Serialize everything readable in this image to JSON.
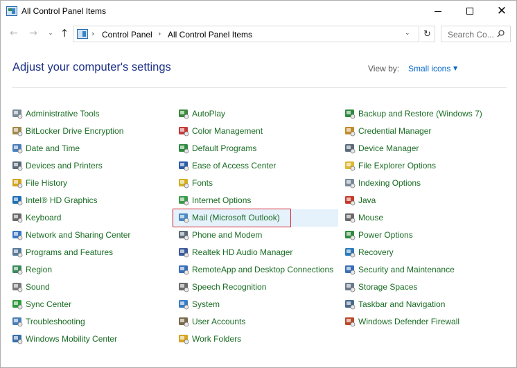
{
  "window": {
    "title": "All Control Panel Items",
    "controls": {
      "minimize": "minimize",
      "maximize": "maximize",
      "close": "✕"
    }
  },
  "address": {
    "crumbs": [
      "Control Panel",
      "All Control Panel Items"
    ],
    "search_placeholder": "Search Co..."
  },
  "content": {
    "heading": "Adjust your computer's settings",
    "view_by_label": "View by:",
    "view_by_value": "Small icons"
  },
  "columns": [
    [
      {
        "label": "Administrative Tools",
        "icon": "gear-tools-icon",
        "color": "#7a8a99"
      },
      {
        "label": "BitLocker Drive Encryption",
        "icon": "drive-key-icon",
        "color": "#a08a4a"
      },
      {
        "label": "Date and Time",
        "icon": "clock-icon",
        "color": "#4a7fb8"
      },
      {
        "label": "Devices and Printers",
        "icon": "printer-icon",
        "color": "#5a6a7a"
      },
      {
        "label": "File History",
        "icon": "file-history-icon",
        "color": "#d4a520"
      },
      {
        "label": "Intel® HD Graphics",
        "icon": "intel-icon",
        "color": "#1f6fb5"
      },
      {
        "label": "Keyboard",
        "icon": "keyboard-icon",
        "color": "#6a6a6a"
      },
      {
        "label": "Network and Sharing Center",
        "icon": "network-icon",
        "color": "#3a78c4"
      },
      {
        "label": "Programs and Features",
        "icon": "programs-icon",
        "color": "#5a7a9a"
      },
      {
        "label": "Region",
        "icon": "globe-clock-icon",
        "color": "#3a8a5a"
      },
      {
        "label": "Sound",
        "icon": "speaker-icon",
        "color": "#7a7a7a"
      },
      {
        "label": "Sync Center",
        "icon": "sync-icon",
        "color": "#2e9b3e"
      },
      {
        "label": "Troubleshooting",
        "icon": "troubleshoot-icon",
        "color": "#4a7fb8"
      },
      {
        "label": "Windows Mobility Center",
        "icon": "mobility-icon",
        "color": "#3a6fa8"
      }
    ],
    [
      {
        "label": "AutoPlay",
        "icon": "autoplay-icon",
        "color": "#3a8a3a"
      },
      {
        "label": "Color Management",
        "icon": "color-monitor-icon",
        "color": "#c43a3a"
      },
      {
        "label": "Default Programs",
        "icon": "default-programs-icon",
        "color": "#2e8b3e"
      },
      {
        "label": "Ease of Access Center",
        "icon": "ease-access-icon",
        "color": "#2a5aa8"
      },
      {
        "label": "Fonts",
        "icon": "fonts-icon",
        "color": "#d4b020"
      },
      {
        "label": "Internet Options",
        "icon": "internet-icon",
        "color": "#3a9a4a"
      },
      {
        "label": "Mail (Microsoft Outlook)",
        "icon": "mail-icon",
        "color": "#4a8ac4"
      },
      {
        "label": "Phone and Modem",
        "icon": "phone-icon",
        "color": "#5a6a7a"
      },
      {
        "label": "Realtek HD Audio Manager",
        "icon": "audio-manager-icon",
        "color": "#3a5a9a"
      },
      {
        "label": "RemoteApp and Desktop Connections",
        "icon": "remote-app-icon",
        "color": "#3a6fb8"
      },
      {
        "label": "Speech Recognition",
        "icon": "microphone-icon",
        "color": "#6a6a6a"
      },
      {
        "label": "System",
        "icon": "system-icon",
        "color": "#3a7ac4"
      },
      {
        "label": "User Accounts",
        "icon": "users-icon",
        "color": "#7a6a4a"
      },
      {
        "label": "Work Folders",
        "icon": "work-folders-icon",
        "color": "#d4a520"
      }
    ],
    [
      {
        "label": "Backup and Restore (Windows 7)",
        "icon": "backup-icon",
        "color": "#2e8b3e"
      },
      {
        "label": "Credential Manager",
        "icon": "credential-icon",
        "color": "#c48a2a"
      },
      {
        "label": "Device Manager",
        "icon": "device-manager-icon",
        "color": "#5a6a7a"
      },
      {
        "label": "File Explorer Options",
        "icon": "folder-options-icon",
        "color": "#e0b830"
      },
      {
        "label": "Indexing Options",
        "icon": "indexing-icon",
        "color": "#7a8a9a"
      },
      {
        "label": "Java",
        "icon": "java-icon",
        "color": "#c43a2a"
      },
      {
        "label": "Mouse",
        "icon": "mouse-icon",
        "color": "#6a6a6a"
      },
      {
        "label": "Power Options",
        "icon": "power-icon",
        "color": "#2e8b3e"
      },
      {
        "label": "Recovery",
        "icon": "recovery-icon",
        "color": "#2a7ab8"
      },
      {
        "label": "Security and Maintenance",
        "icon": "flag-icon",
        "color": "#3a6fb8"
      },
      {
        "label": "Storage Spaces",
        "icon": "storage-icon",
        "color": "#6a7a8a"
      },
      {
        "label": "Taskbar and Navigation",
        "icon": "taskbar-icon",
        "color": "#4a6a8a"
      },
      {
        "label": "Windows Defender Firewall",
        "icon": "firewall-icon",
        "color": "#b84a2a"
      }
    ]
  ],
  "colors": {
    "link": "#1a6c24",
    "heading": "#1e3287",
    "accent": "#0066cc",
    "highlight_border": "#d9262f",
    "highlight_bg": "#e5f1fb"
  }
}
